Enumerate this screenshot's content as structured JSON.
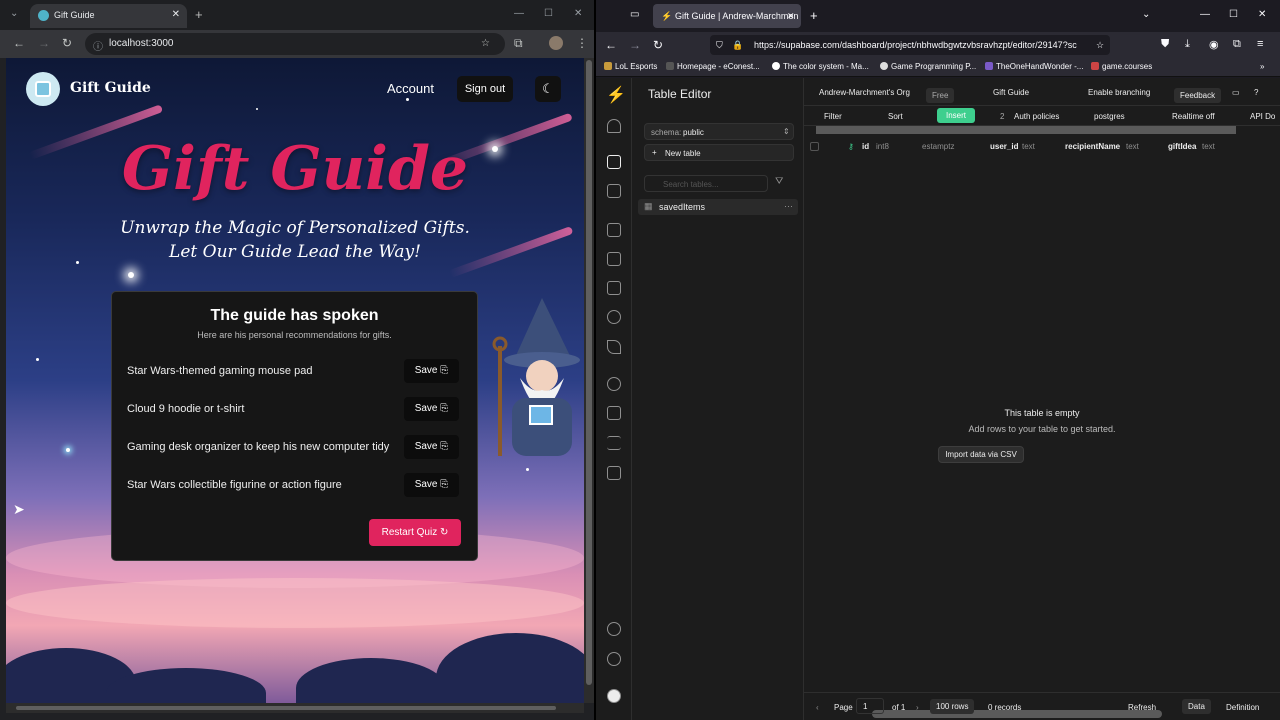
{
  "left_browser": {
    "tab_title": "Gift Guide",
    "tab_close": "✕",
    "new_tab": "+",
    "url": "localhost:3000",
    "window_controls": [
      "—",
      "☐",
      "✕"
    ]
  },
  "app": {
    "brand": "Gift Guide",
    "nav_account": "Account",
    "nav_signout": "Sign out",
    "hero_title": "Gift Guide",
    "tagline_1": "Unwrap the Magic of Personalized Gifts.",
    "tagline_2": "Let Our Guide Lead the Way!",
    "card_title": "The guide has spoken",
    "card_subtitle": "Here are his personal recommendations for gifts.",
    "recommendations": [
      "Star Wars-themed gaming mouse pad",
      "Cloud 9 hoodie or t-shirt",
      "Gaming desk organizer to keep his new computer tidy",
      "Star Wars collectible figurine or action figure"
    ],
    "save_label": "Save",
    "restart_label": "Restart Quiz",
    "accent": "#e0245e"
  },
  "right_browser": {
    "tab_title": "Gift Guide | Andrew-Marchmen",
    "url": "https://supabase.com/dashboard/project/nbhwdbgwtzvbsravhzpt/editor/29147?sc",
    "bookmarks": [
      "LoL Esports",
      "Homepage - eConest...",
      "The color system - Ma...",
      "Game Programming P...",
      "TheOneHandWonder -...",
      "game.courses"
    ]
  },
  "supabase": {
    "section_title": "Table Editor",
    "schema_label": "schema:",
    "schema_value": "public",
    "new_table": "New table",
    "search_placeholder": "Search tables...",
    "tables": [
      "savedItems"
    ],
    "org": "Andrew-Marchment's Org",
    "plan": "Free",
    "project": "Gift Guide",
    "enable_branching": "Enable branching",
    "feedback": "Feedback",
    "toolbar": {
      "filter": "Filter",
      "sort": "Sort",
      "insert": "Insert",
      "auth_count": "2",
      "auth_policies": "Auth policies",
      "role": "postgres",
      "realtime": "Realtime off",
      "api_docs": "API Do"
    },
    "columns": [
      {
        "name": "id",
        "type": "int8"
      },
      {
        "name": "",
        "type": "estamptz"
      },
      {
        "name": "user_id",
        "type": "text"
      },
      {
        "name": "recipientName",
        "type": "text"
      },
      {
        "name": "giftIdea",
        "type": "text"
      }
    ],
    "empty_title": "This table is empty",
    "empty_sub": "Add rows to your table to get started.",
    "import_csv": "Import data via CSV",
    "footer": {
      "page_label": "Page",
      "page_value": "1",
      "of": "of 1",
      "rows": "100 rows",
      "records": "0 records",
      "refresh": "Refresh",
      "data": "Data",
      "definition": "Definition"
    }
  }
}
